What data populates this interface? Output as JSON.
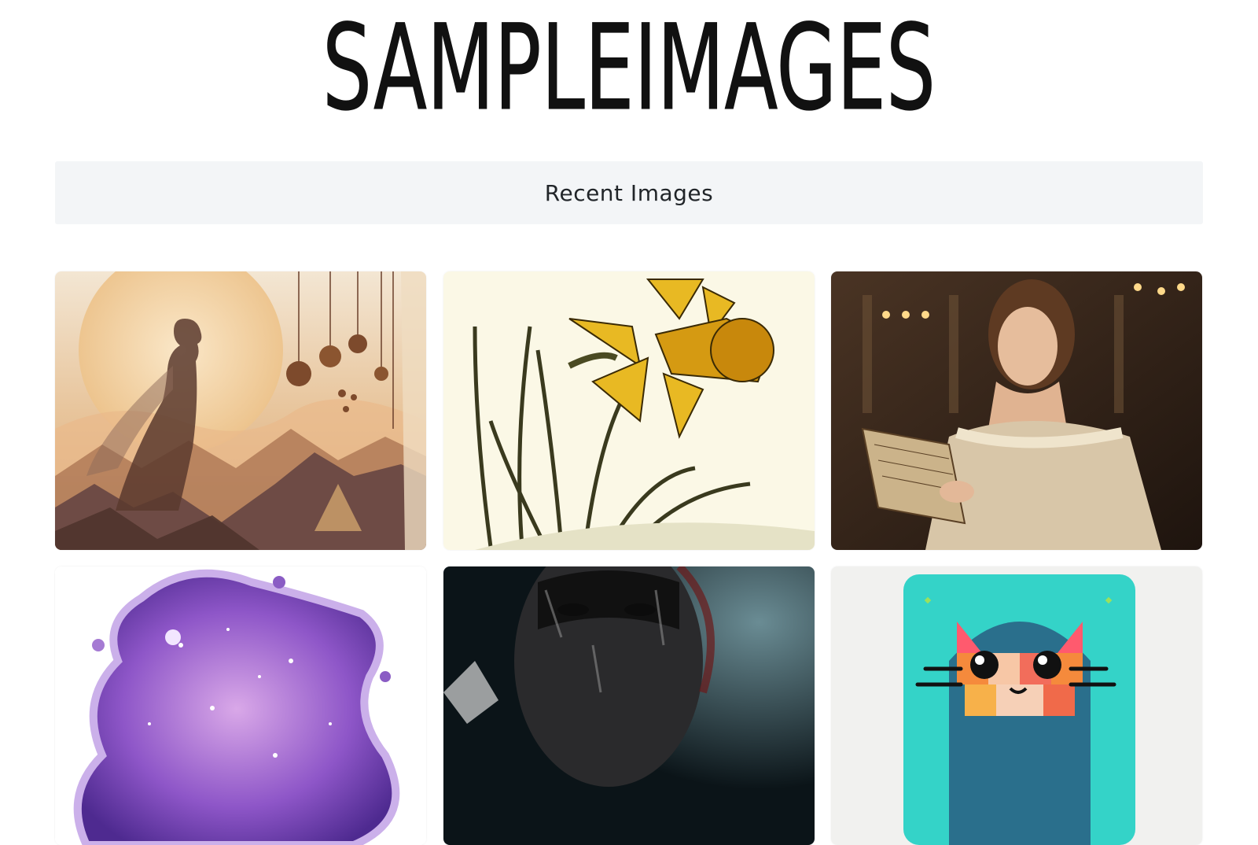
{
  "site": {
    "logo_text": "SAMPLEIMAGES"
  },
  "section": {
    "heading": "Recent Images"
  },
  "gallery": {
    "images": [
      {
        "subject": "watercolor-silhouette-woman-mountains-sitars"
      },
      {
        "subject": "yellow-daffodil-illustration"
      },
      {
        "subject": "woman-in-lace-dress-reading-sheet-music"
      },
      {
        "subject": "purple-galaxy-paint-splash"
      },
      {
        "subject": "dark-painted-face-portrait"
      },
      {
        "subject": "geometric-pixel-cat-face"
      }
    ]
  },
  "colors": {
    "bar_background": "#f3f5f7",
    "heading_text": "#212529",
    "logo": "#111111"
  }
}
